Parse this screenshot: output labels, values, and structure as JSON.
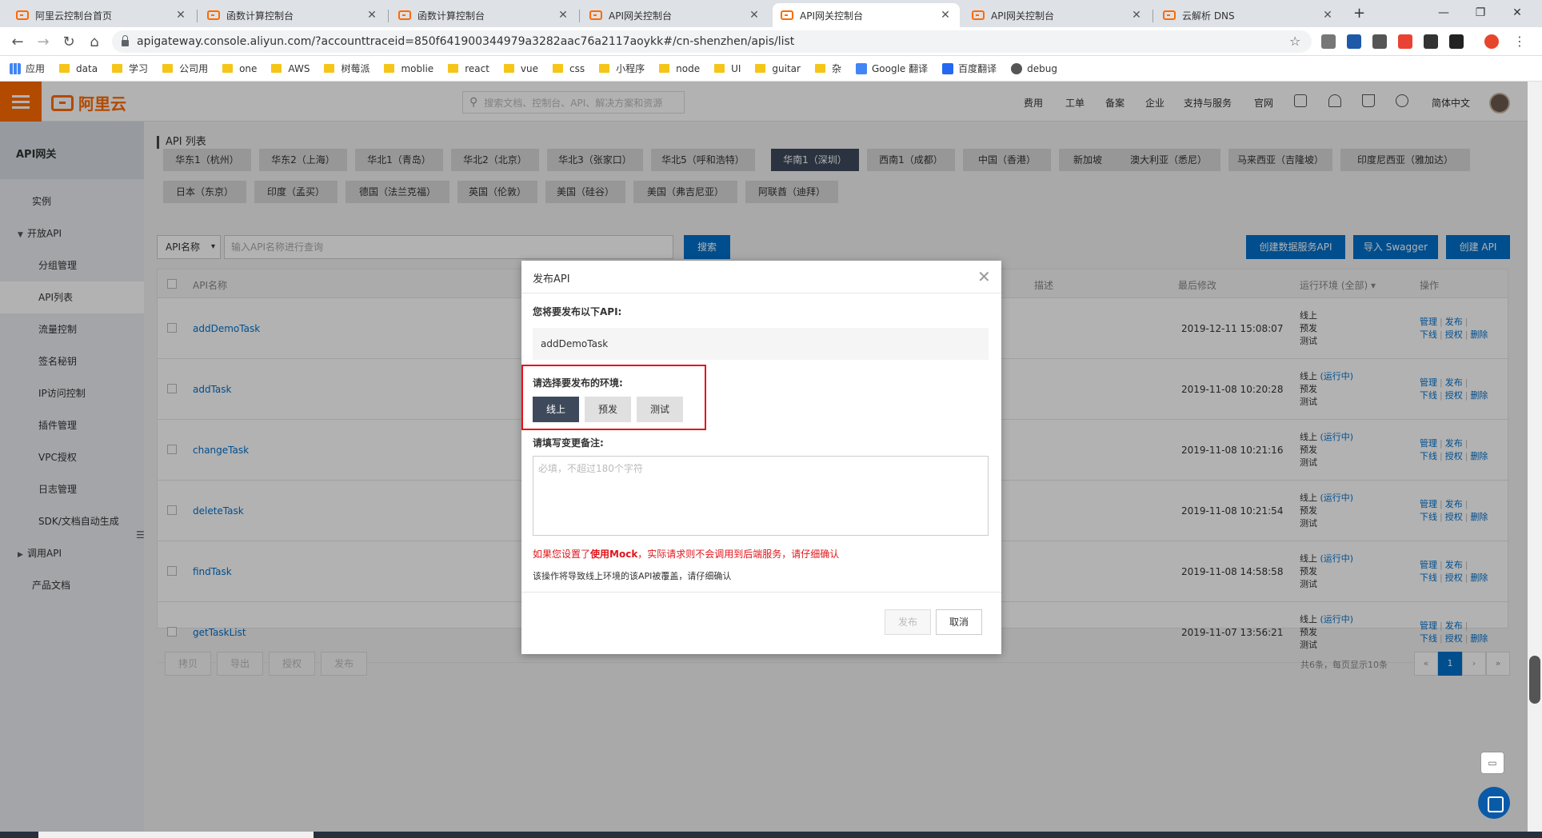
{
  "browser": {
    "tabs": [
      {
        "title": "阿里云控制台首页"
      },
      {
        "title": "函数计算控制台"
      },
      {
        "title": "函数计算控制台"
      },
      {
        "title": "API网关控制台"
      },
      {
        "title": "API网关控制台"
      },
      {
        "title": "API网关控制台"
      },
      {
        "title": "云解析 DNS"
      }
    ],
    "new_tab": "+",
    "url": "apigateway.console.aliyun.com/?accounttraceid=850f641900344979a3282aac76a2117aoykk#/cn-shenzhen/apis/list",
    "bookmarks": [
      "应用",
      "data",
      "学习",
      "公司用",
      "one",
      "AWS",
      "树莓派",
      "moblie",
      "react",
      "vue",
      "css",
      "小程序",
      "node",
      "UI",
      "guitar",
      "杂",
      "Google 翻译",
      "百度翻译",
      "debug"
    ]
  },
  "topnav": {
    "logo": "阿里云",
    "search_placeholder": "搜索文档、控制台、API、解决方案和资源",
    "links": [
      "费用",
      "工单",
      "备案",
      "企业",
      "支持与服务",
      "官网"
    ],
    "language": "简体中文"
  },
  "sidebar": {
    "title": "API网关",
    "items": [
      {
        "label": "实例",
        "type": "l1"
      },
      {
        "label": "开放API",
        "type": "group",
        "arrow": "▼"
      },
      {
        "label": "分组管理",
        "type": "sub"
      },
      {
        "label": "API列表",
        "type": "sub",
        "active": true
      },
      {
        "label": "流量控制",
        "type": "sub"
      },
      {
        "label": "签名秘钥",
        "type": "sub"
      },
      {
        "label": "IP访问控制",
        "type": "sub"
      },
      {
        "label": "插件管理",
        "type": "sub"
      },
      {
        "label": "VPC授权",
        "type": "sub"
      },
      {
        "label": "日志管理",
        "type": "sub"
      },
      {
        "label": "SDK/文档自动生成",
        "type": "sub"
      },
      {
        "label": "调用API",
        "type": "group",
        "arrow": "▶"
      },
      {
        "label": "产品文档",
        "type": "l1"
      }
    ]
  },
  "content": {
    "page_title": "API 列表",
    "regions_row1": [
      "华东1（杭州）",
      "华东2（上海）",
      "华北1（青岛）",
      "华北2（北京）",
      "华北3（张家口）",
      "华北5（呼和浩特）",
      "华南1（深圳）",
      "西南1（成都）",
      "中国（香港）",
      "新加坡",
      "澳大利亚（悉尼）",
      "马来西亚（吉隆坡）",
      "印度尼西亚（雅加达）"
    ],
    "regions_row2": [
      "日本（东京）",
      "印度（孟买）",
      "德国（法兰克福）",
      "英国（伦敦）",
      "美国（硅谷）",
      "美国（弗吉尼亚）",
      "阿联酋（迪拜）"
    ],
    "active_region": "华南1（深圳）",
    "filter_select": "API名称",
    "filter_placeholder": "输入API名称进行查询",
    "search_btn": "搜索",
    "btn_create_data": "创建数据服务API",
    "btn_import": "导入 Swagger",
    "btn_create": "创建 API",
    "columns": {
      "name": "API名称",
      "desc": "描述",
      "modified": "最后修改",
      "env": "运行环境 (全部) ▾",
      "ops": "操作"
    },
    "rows": [
      {
        "name": "addDemoTask",
        "date": "2019-12-11 15:08:07",
        "env1": "线上",
        "run": "",
        "env2": "预发",
        "env3": "测试"
      },
      {
        "name": "addTask",
        "date": "2019-11-08 10:20:28",
        "env1": "线上",
        "run": "(运行中)",
        "env2": "预发",
        "env3": "测试"
      },
      {
        "name": "changeTask",
        "date": "2019-11-08 10:21:16",
        "env1": "线上",
        "run": "(运行中)",
        "env2": "预发",
        "env3": "测试"
      },
      {
        "name": "deleteTask",
        "date": "2019-11-08 10:21:54",
        "env1": "线上",
        "run": "(运行中)",
        "env2": "预发",
        "env3": "测试"
      },
      {
        "name": "findTask",
        "date": "2019-11-08 14:58:58",
        "env1": "线上",
        "run": "(运行中)",
        "env2": "预发",
        "env3": "测试"
      },
      {
        "name": "getTaskList",
        "date": "2019-11-07 13:56:21",
        "env1": "线上",
        "run": "(运行中)",
        "env2": "预发",
        "env3": "测试"
      }
    ],
    "row_actions": {
      "manage": "管理",
      "publish": "发布",
      "offline": "下线",
      "auth": "授权",
      "delete": "删除"
    },
    "bottom_btns": [
      "拷贝",
      "导出",
      "授权",
      "发布"
    ],
    "page_summary": "共6条，每页显示10条",
    "pager": {
      "prev_first": "«",
      "prev": "‹",
      "current": "1",
      "next": "›",
      "next_last": "»"
    }
  },
  "modal": {
    "title": "发布API",
    "label_api": "您将要发布以下API:",
    "api_name": "addDemoTask",
    "label_env": "请选择要发布的环境:",
    "envs": [
      "线上",
      "预发",
      "测试"
    ],
    "selected_env": "线上",
    "label_remark": "请填写变更备注:",
    "remark_placeholder": "必填，不超过180个字符",
    "warn_pre": "如果您设置了",
    "warn_bold": "使用Mock",
    "warn_post": "，实际请求则不会调用到后端服务，请仔细确认",
    "note": "该操作将导致线上环境的该API被覆盖，请仔细确认",
    "btn_publish": "发布",
    "btn_cancel": "取消"
  },
  "colors": {
    "accent": "#ff6a00",
    "primary": "#0070cc",
    "dark": "#3e4a5c",
    "highlight_border": "#e3141b"
  }
}
